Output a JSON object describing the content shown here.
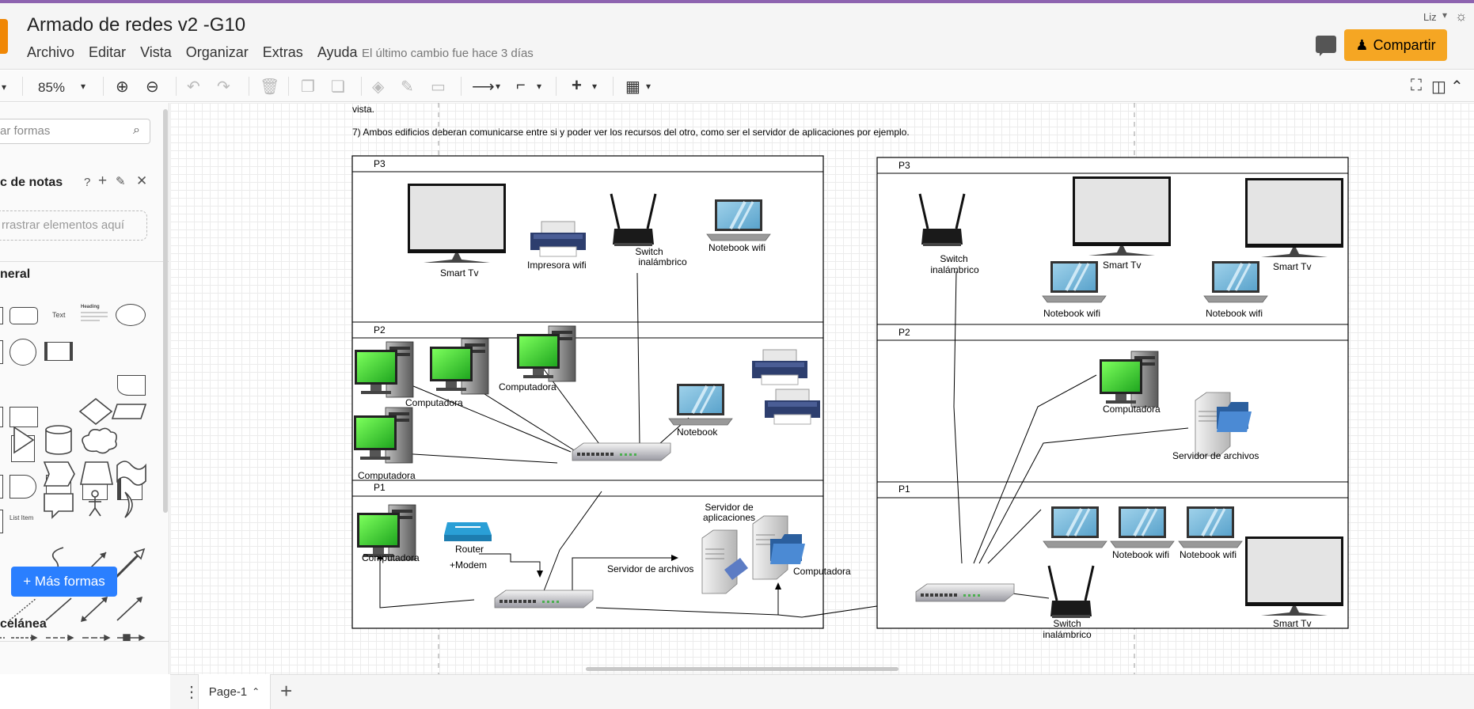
{
  "app": {
    "title": "Armado de redes v2 -G10",
    "menu": [
      "Archivo",
      "Editar",
      "Vista",
      "Organizar",
      "Extras",
      "Ayuda"
    ],
    "last_change": "El último cambio fue hace 3 días",
    "user": "Liz",
    "share_label": "Compartir"
  },
  "toolbar": {
    "zoom": "85%"
  },
  "sidebar": {
    "search_placeholder": "ar formas",
    "scratchpad_title": "c de notas",
    "scratchpad_drop": "rrastrar elementos aquí",
    "general_title": "neral",
    "misc_title": "celánea",
    "text_shape_label": "Text",
    "heading_shape_label": "Heading",
    "list_item_label": "List Item",
    "more_shapes": "Más formas"
  },
  "canvas": {
    "note_top": "vista.",
    "note_7": "7) Ambos edificios deberan comunicarse entre si y poder ver los recursos del otro, como ser el servidor de aplicaciones por ejemplo.",
    "floors": {
      "p3": "P3",
      "p2": "P2",
      "p1": "P1"
    },
    "labels": {
      "smart_tv": "Smart Tv",
      "impresora": "Impresora wifi",
      "switch_inal_1": "Switch",
      "switch_inal_2": "inalámbrico",
      "notebook_wifi": "Notebook wifi",
      "computadora": "Computadora",
      "notebook": "Notebook",
      "router": "Router",
      "modem": "+Modem",
      "servidor_apps_1": "Servidor de",
      "servidor_apps_2": "aplicaciones",
      "servidor_archivos": "Servidor de archivos"
    }
  },
  "footer": {
    "page_name": "Page-1"
  }
}
